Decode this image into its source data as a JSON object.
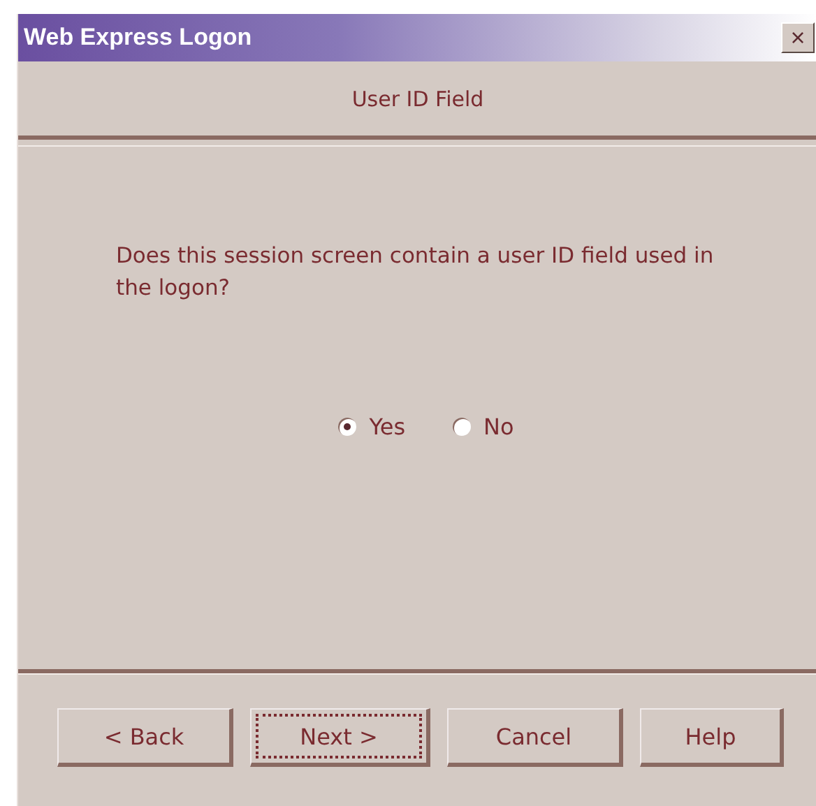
{
  "window": {
    "title": "Web Express Logon",
    "close": "×"
  },
  "header": {
    "title": "User ID Field"
  },
  "question": "Does this session screen contain a user ID field used in the logon?",
  "options": [
    {
      "label": "Yes",
      "selected": true
    },
    {
      "label": "No",
      "selected": false
    }
  ],
  "buttons": [
    {
      "label": "< Back",
      "focused": false
    },
    {
      "label": "Next >",
      "focused": true
    },
    {
      "label": "Cancel",
      "focused": false
    },
    {
      "label": "Help",
      "focused": false
    }
  ]
}
